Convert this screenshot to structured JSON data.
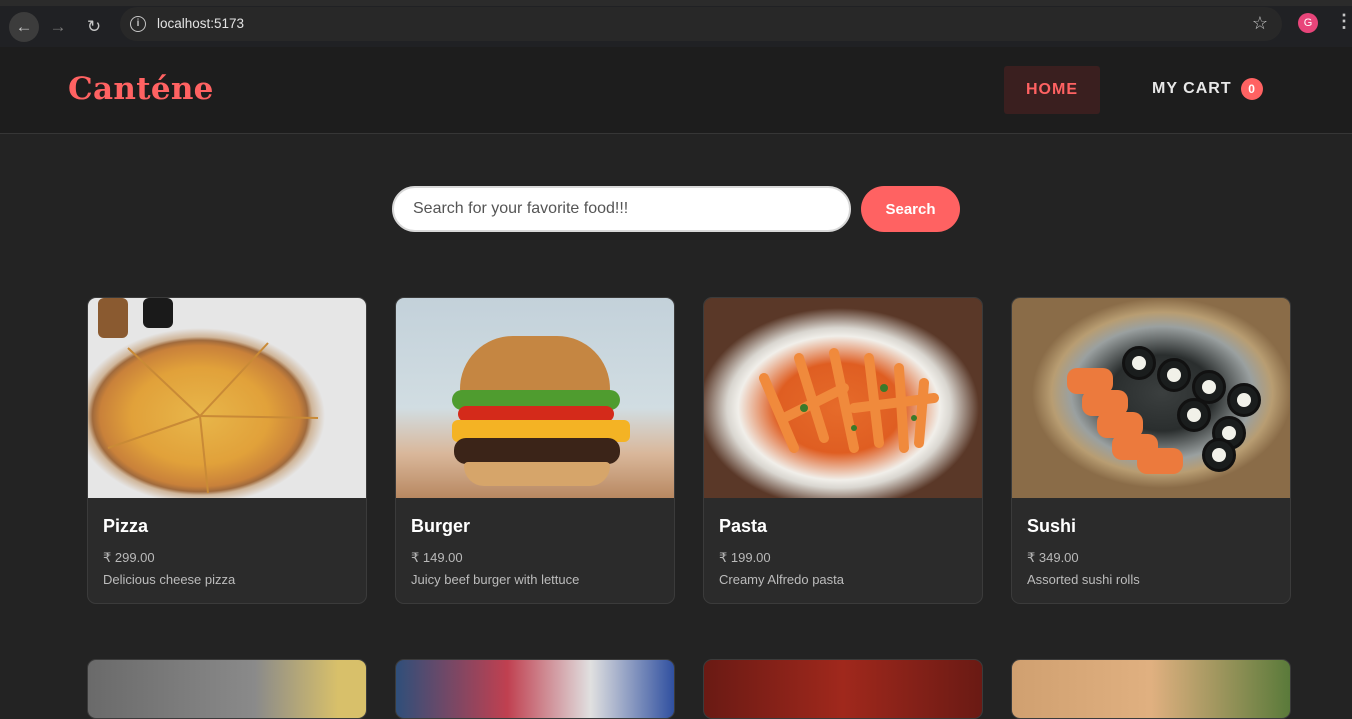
{
  "browser": {
    "url": "localhost:5173",
    "profile_initial": "G"
  },
  "header": {
    "logo": "Canténe",
    "nav": {
      "home": "HOME",
      "cart": "MY CART",
      "cart_count": "0"
    }
  },
  "search": {
    "placeholder": "Search for your favorite food!!!",
    "button": "Search"
  },
  "products": [
    {
      "name": "Pizza",
      "price": "₹ 299.00",
      "description": "Delicious cheese pizza",
      "image": "pizza-image"
    },
    {
      "name": "Burger",
      "price": "₹ 149.00",
      "description": "Juicy beef burger with lettuce",
      "image": "burger-image"
    },
    {
      "name": "Pasta",
      "price": "₹ 199.00",
      "description": "Creamy Alfredo pasta",
      "image": "pasta-image"
    },
    {
      "name": "Sushi",
      "price": "₹ 349.00",
      "description": "Assorted sushi rolls",
      "image": "sushi-image"
    }
  ],
  "colors": {
    "accent": "#ff6262",
    "background": "#232323",
    "header": "#1d1d1d",
    "card": "#2b2b2b"
  }
}
